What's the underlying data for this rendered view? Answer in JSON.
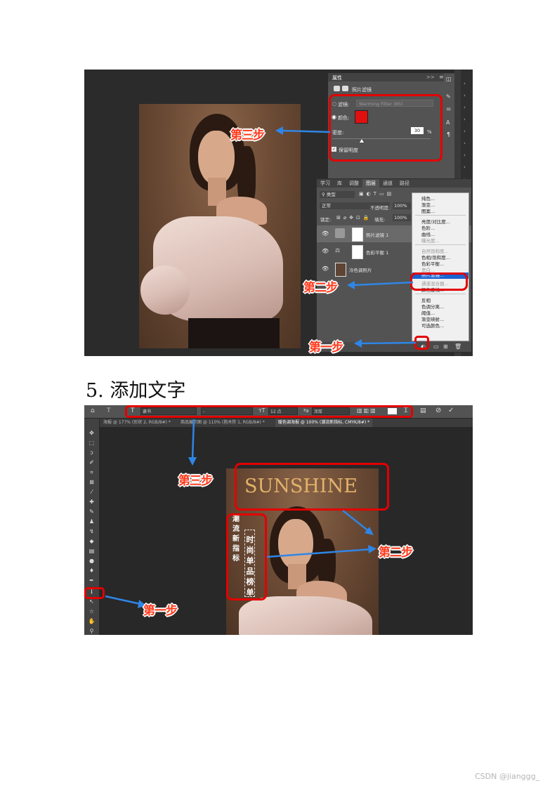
{
  "screenshot1": {
    "properties_panel": {
      "title": "属性",
      "collapse_label": ">>",
      "subtitle": "照片滤镜",
      "filter_label": "滤镜:",
      "filter_value": "Warming Filter (85)",
      "color_label": "颜色:",
      "color_swatch": "#e01010",
      "density_label": "密度:",
      "density_value": "30",
      "density_unit": "%",
      "density_level": 0.3,
      "preserve_label": "保留明度"
    },
    "layers_panel": {
      "tabs": [
        "学习",
        "库",
        "调整",
        "图层",
        "通道",
        "路径"
      ],
      "active_tab": "图层",
      "filter_kind": "类型",
      "blend_mode": "正常",
      "opacity_label": "不透明度:",
      "opacity_value": "100%",
      "lock_label": "锁定:",
      "fill_label": "填充:",
      "fill_value": "100%",
      "layers": [
        {
          "name": "照片滤镜 1"
        },
        {
          "name": "色彩平衡 1"
        },
        {
          "name": "冷色调照片"
        }
      ]
    },
    "adjust_menu": {
      "items": [
        {
          "label": "纯色...",
          "state": "normal"
        },
        {
          "label": "渐变...",
          "state": "normal"
        },
        {
          "label": "图案...",
          "state": "normal"
        },
        {
          "label": "亮度/对比度...",
          "state": "normal"
        },
        {
          "label": "色阶...",
          "state": "normal"
        },
        {
          "label": "曲线...",
          "state": "normal"
        },
        {
          "label": "曝光度...",
          "state": "dim"
        },
        {
          "label": "自然饱和度...",
          "state": "dim"
        },
        {
          "label": "色相/饱和度...",
          "state": "normal"
        },
        {
          "label": "色彩平衡...",
          "state": "normal"
        },
        {
          "label": "黑白...",
          "state": "dim"
        },
        {
          "label": "照片滤镜...",
          "state": "selected"
        },
        {
          "label": "通道混合器...",
          "state": "dim"
        },
        {
          "label": "颜色查找...",
          "state": "normal"
        },
        {
          "label": "反相",
          "state": "normal"
        },
        {
          "label": "色调分离...",
          "state": "normal"
        },
        {
          "label": "阈值...",
          "state": "normal"
        },
        {
          "label": "渐变映射...",
          "state": "normal"
        },
        {
          "label": "可选颜色...",
          "state": "normal"
        }
      ]
    },
    "annotations": {
      "step3": "第三步",
      "step2": "第二步",
      "step1": "第一步"
    }
  },
  "heading": "5.  添加文字",
  "screenshot2": {
    "options_bar": {
      "font_family": "隶书",
      "font_style": "-",
      "font_size": "12 点",
      "antialias": "浑厚"
    },
    "doc_tabs": [
      "海报 @ 177% (形状 2, RGB/8#) *",
      "商品展示图 @ 110% (抱木符 1, RGB/8#) *",
      "暖色调海报 @ 100% (潮流新指标, CMYK/8#) *"
    ],
    "poster": {
      "headline": "SUNSHINE",
      "vertical_text_1": "潮流新指标",
      "vertical_text_2": "时尚单品榜单"
    },
    "annotations": {
      "step3": "第三步",
      "step2": "第二步",
      "step1": "第一步"
    }
  },
  "watermark": "CSDN @jianggg_",
  "colors": {
    "annotation_red": "#e30000",
    "arrow_blue": "#2f86e6",
    "menu_highlight": "#1a63d1",
    "poster_gold": "#e3b26a"
  }
}
